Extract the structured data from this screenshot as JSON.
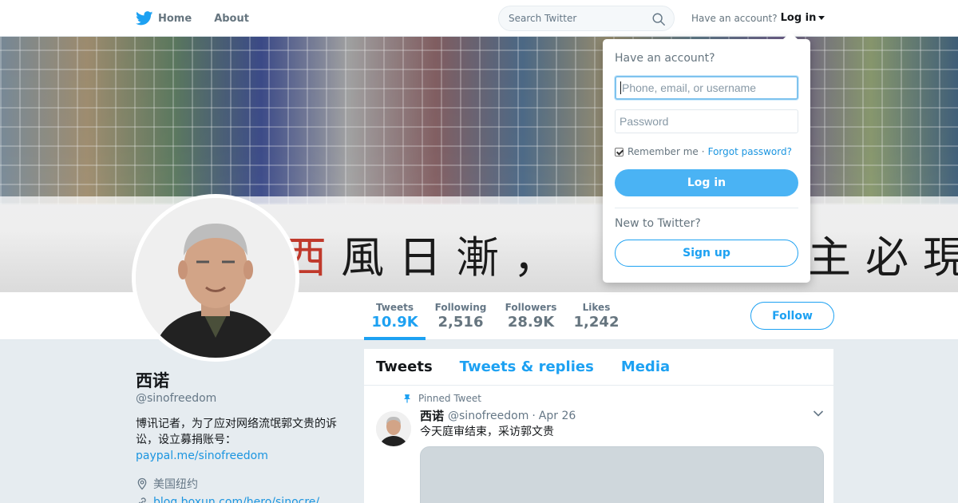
{
  "nav": {
    "home_label": "Home",
    "about_label": "About",
    "search_placeholder": "Search Twitter",
    "have_account": "Have an account?",
    "login_label": "Log in"
  },
  "banner": {
    "calligraphy_left": "西風日漸，",
    "calligraphy_left_red": "西",
    "calligraphy_left_rest": "風日漸，",
    "calligraphy_right": "主必現"
  },
  "stats": [
    {
      "label": "Tweets",
      "value": "10.9K"
    },
    {
      "label": "Following",
      "value": "2,516"
    },
    {
      "label": "Followers",
      "value": "28.9K"
    },
    {
      "label": "Likes",
      "value": "1,242"
    }
  ],
  "follow_label": "Follow",
  "profile": {
    "name": "西诺",
    "handle": "@sinofreedom",
    "bio": "博讯记者，为了应对网络流氓郭文贵的诉讼，设立募捐账号：",
    "bio_link": "paypal.me/sinofreedom",
    "location": "美国纽约",
    "url": "blog.boxun.com/hero/sinocre/"
  },
  "timeline": {
    "tabs": [
      "Tweets",
      "Tweets & replies",
      "Media"
    ],
    "pinned_label": "Pinned Tweet",
    "tweet": {
      "name": "西诺",
      "handle": "@sinofreedom",
      "date": "Apr 26",
      "text": "今天庭审结束，采访郭文贵"
    }
  },
  "login_popup": {
    "title": "Have an account?",
    "username_placeholder": "Phone, email, or username",
    "password_placeholder": "Password",
    "remember": "Remember me",
    "separator": "·",
    "forgot": "Forgot password?",
    "login_button": "Log in",
    "new_to": "New to Twitter?",
    "signup_button": "Sign up"
  },
  "colors": {
    "brand_blue": "#1da1f2",
    "link_blue": "#1b95e0",
    "background": "#e6ecf0"
  }
}
